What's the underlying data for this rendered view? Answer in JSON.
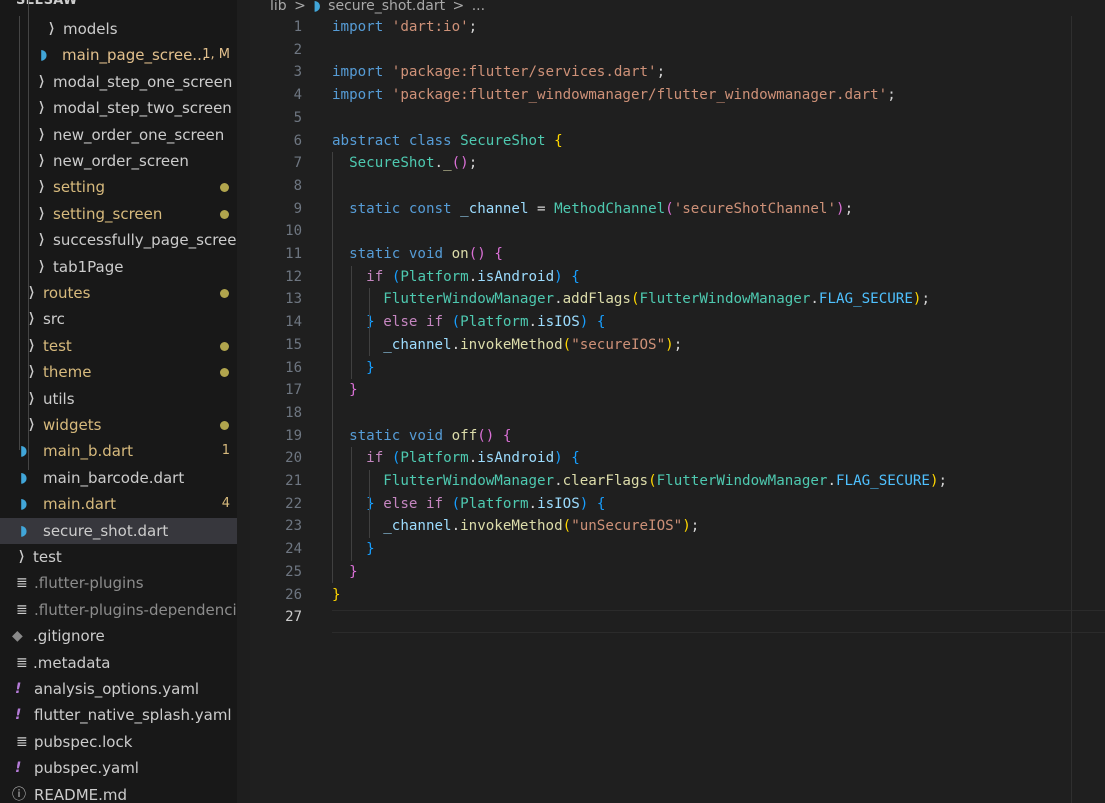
{
  "explorer": {
    "title": "SEESAW",
    "rows": [
      {
        "label": "models",
        "kind": "folder",
        "color": "#cccccc"
      },
      {
        "label": "main_page_scree...",
        "kind": "dart",
        "color": "#e2c08d",
        "badge": "1, M",
        "badge_color": "#e2c08d"
      },
      {
        "label": "modal_step_one_screen",
        "kind": "folder",
        "color": "#cccccc"
      },
      {
        "label": "modal_step_two_screen",
        "kind": "folder",
        "color": "#cccccc"
      },
      {
        "label": "new_order_one_screen",
        "kind": "folder",
        "color": "#cccccc"
      },
      {
        "label": "new_order_screen",
        "kind": "folder",
        "color": "#cccccc"
      },
      {
        "label": "setting",
        "kind": "folder",
        "color": "#d7ba7d",
        "dot": true
      },
      {
        "label": "setting_screen",
        "kind": "folder",
        "color": "#d7ba7d",
        "dot": true
      },
      {
        "label": "successfully_page_screen",
        "kind": "folder",
        "color": "#cccccc"
      },
      {
        "label": "tab1Page",
        "kind": "folder",
        "color": "#cccccc"
      },
      {
        "label": "routes",
        "kind": "folder",
        "color": "#d7ba7d",
        "dot": true
      },
      {
        "label": "src",
        "kind": "folder",
        "color": "#cccccc"
      },
      {
        "label": "test",
        "kind": "folder",
        "color": "#d7ba7d",
        "dot": true
      },
      {
        "label": "theme",
        "kind": "folder",
        "color": "#d7ba7d",
        "dot": true
      },
      {
        "label": "utils",
        "kind": "folder",
        "color": "#cccccc"
      },
      {
        "label": "widgets",
        "kind": "folder",
        "color": "#d7ba7d",
        "dot": true
      },
      {
        "label": "main_b.dart",
        "kind": "dart",
        "color": "#d7ba7d",
        "badge": "1",
        "badge_color": "#d7ba7d"
      },
      {
        "label": "main_barcode.dart",
        "kind": "dart",
        "color": "#cccccc"
      },
      {
        "label": "main.dart",
        "kind": "dart",
        "color": "#d7ba7d",
        "badge": "4",
        "badge_color": "#d7ba7d"
      },
      {
        "label": "secure_shot.dart",
        "kind": "dart",
        "color": "#cccccc",
        "selected": true
      },
      {
        "label": "test",
        "kind": "folder",
        "color": "#cccccc"
      },
      {
        "label": ".flutter-plugins",
        "kind": "lines",
        "color": "#8c8c8c"
      },
      {
        "label": ".flutter-plugins-dependencies",
        "kind": "lines",
        "color": "#8c8c8c"
      },
      {
        "label": ".gitignore",
        "kind": "git",
        "color": "#cccccc"
      },
      {
        "label": ".metadata",
        "kind": "lines",
        "color": "#cccccc"
      },
      {
        "label": "analysis_options.yaml",
        "kind": "yaml",
        "color": "#cccccc"
      },
      {
        "label": "flutter_native_splash.yaml",
        "kind": "yaml",
        "color": "#cccccc"
      },
      {
        "label": "pubspec.lock",
        "kind": "lines",
        "color": "#cccccc"
      },
      {
        "label": "pubspec.yaml",
        "kind": "yaml",
        "color": "#cccccc"
      },
      {
        "label": "README.md",
        "kind": "info",
        "color": "#cccccc"
      }
    ]
  },
  "breadcrumb": {
    "folder": "lib",
    "separator": ">",
    "file": "secure_shot.dart",
    "more": "..."
  },
  "editor": {
    "active_line": 27,
    "lines": [
      [
        [
          "kw",
          "import"
        ],
        [
          "df",
          " "
        ],
        [
          "st",
          "'dart:io'"
        ],
        [
          "df",
          ";"
        ]
      ],
      [],
      [
        [
          "kw",
          "import"
        ],
        [
          "df",
          " "
        ],
        [
          "st",
          "'package:flutter/services.dart'"
        ],
        [
          "df",
          ";"
        ]
      ],
      [
        [
          "kw",
          "import"
        ],
        [
          "df",
          " "
        ],
        [
          "st",
          "'package:flutter_windowmanager/flutter_windowmanager.dart'"
        ],
        [
          "df",
          ";"
        ]
      ],
      [],
      [
        [
          "kw",
          "abstract"
        ],
        [
          "df",
          " "
        ],
        [
          "kw",
          "class"
        ],
        [
          "df",
          " "
        ],
        [
          "ty",
          "SecureShot"
        ],
        [
          "df",
          " "
        ],
        [
          "p1",
          "{"
        ]
      ],
      [
        [
          "df",
          "  "
        ],
        [
          "ty",
          "SecureShot"
        ],
        [
          "df",
          "."
        ],
        [
          "fn",
          "_"
        ],
        [
          "p2",
          "()"
        ],
        [
          "df",
          ";"
        ]
      ],
      [],
      [
        [
          "df",
          "  "
        ],
        [
          "kw",
          "static"
        ],
        [
          "df",
          " "
        ],
        [
          "kw",
          "const"
        ],
        [
          "df",
          " "
        ],
        [
          "pr",
          "_channel"
        ],
        [
          "df",
          " = "
        ],
        [
          "ty",
          "MethodChannel"
        ],
        [
          "p2",
          "("
        ],
        [
          "st",
          "'secureShotChannel'"
        ],
        [
          "p2",
          ")"
        ],
        [
          "df",
          ";"
        ]
      ],
      [],
      [
        [
          "df",
          "  "
        ],
        [
          "kw",
          "static"
        ],
        [
          "df",
          " "
        ],
        [
          "kw",
          "void"
        ],
        [
          "df",
          " "
        ],
        [
          "fn",
          "on"
        ],
        [
          "p2",
          "()"
        ],
        [
          "df",
          " "
        ],
        [
          "p2",
          "{"
        ]
      ],
      [
        [
          "df",
          "    "
        ],
        [
          "kc",
          "if"
        ],
        [
          "df",
          " "
        ],
        [
          "p3",
          "("
        ],
        [
          "ty",
          "Platform"
        ],
        [
          "df",
          "."
        ],
        [
          "pr",
          "isAndroid"
        ],
        [
          "p3",
          ")"
        ],
        [
          "df",
          " "
        ],
        [
          "p3",
          "{"
        ]
      ],
      [
        [
          "df",
          "      "
        ],
        [
          "ty",
          "FlutterWindowManager"
        ],
        [
          "df",
          "."
        ],
        [
          "fn",
          "addFlags"
        ],
        [
          "p1",
          "("
        ],
        [
          "ty",
          "FlutterWindowManager"
        ],
        [
          "df",
          "."
        ],
        [
          "cn",
          "FLAG_SECURE"
        ],
        [
          "p1",
          ")"
        ],
        [
          "df",
          ";"
        ]
      ],
      [
        [
          "df",
          "    "
        ],
        [
          "p3",
          "}"
        ],
        [
          "df",
          " "
        ],
        [
          "kc",
          "else"
        ],
        [
          "df",
          " "
        ],
        [
          "kc",
          "if"
        ],
        [
          "df",
          " "
        ],
        [
          "p3",
          "("
        ],
        [
          "ty",
          "Platform"
        ],
        [
          "df",
          "."
        ],
        [
          "pr",
          "isIOS"
        ],
        [
          "p3",
          ")"
        ],
        [
          "df",
          " "
        ],
        [
          "p3",
          "{"
        ]
      ],
      [
        [
          "df",
          "      "
        ],
        [
          "pr",
          "_channel"
        ],
        [
          "df",
          "."
        ],
        [
          "fn",
          "invokeMethod"
        ],
        [
          "p1",
          "("
        ],
        [
          "st",
          "\"secureIOS\""
        ],
        [
          "p1",
          ")"
        ],
        [
          "df",
          ";"
        ]
      ],
      [
        [
          "df",
          "    "
        ],
        [
          "p3",
          "}"
        ]
      ],
      [
        [
          "df",
          "  "
        ],
        [
          "p2",
          "}"
        ]
      ],
      [],
      [
        [
          "df",
          "  "
        ],
        [
          "kw",
          "static"
        ],
        [
          "df",
          " "
        ],
        [
          "kw",
          "void"
        ],
        [
          "df",
          " "
        ],
        [
          "fn",
          "off"
        ],
        [
          "p2",
          "()"
        ],
        [
          "df",
          " "
        ],
        [
          "p2",
          "{"
        ]
      ],
      [
        [
          "df",
          "    "
        ],
        [
          "kc",
          "if"
        ],
        [
          "df",
          " "
        ],
        [
          "p3",
          "("
        ],
        [
          "ty",
          "Platform"
        ],
        [
          "df",
          "."
        ],
        [
          "pr",
          "isAndroid"
        ],
        [
          "p3",
          ")"
        ],
        [
          "df",
          " "
        ],
        [
          "p3",
          "{"
        ]
      ],
      [
        [
          "df",
          "      "
        ],
        [
          "ty",
          "FlutterWindowManager"
        ],
        [
          "df",
          "."
        ],
        [
          "fn",
          "clearFlags"
        ],
        [
          "p1",
          "("
        ],
        [
          "ty",
          "FlutterWindowManager"
        ],
        [
          "df",
          "."
        ],
        [
          "cn",
          "FLAG_SECURE"
        ],
        [
          "p1",
          ")"
        ],
        [
          "df",
          ";"
        ]
      ],
      [
        [
          "df",
          "    "
        ],
        [
          "p3",
          "}"
        ],
        [
          "df",
          " "
        ],
        [
          "kc",
          "else"
        ],
        [
          "df",
          " "
        ],
        [
          "kc",
          "if"
        ],
        [
          "df",
          " "
        ],
        [
          "p3",
          "("
        ],
        [
          "ty",
          "Platform"
        ],
        [
          "df",
          "."
        ],
        [
          "pr",
          "isIOS"
        ],
        [
          "p3",
          ")"
        ],
        [
          "df",
          " "
        ],
        [
          "p3",
          "{"
        ]
      ],
      [
        [
          "df",
          "      "
        ],
        [
          "pr",
          "_channel"
        ],
        [
          "df",
          "."
        ],
        [
          "fn",
          "invokeMethod"
        ],
        [
          "p1",
          "("
        ],
        [
          "st",
          "\"unSecureIOS\""
        ],
        [
          "p1",
          ")"
        ],
        [
          "df",
          ";"
        ]
      ],
      [
        [
          "df",
          "    "
        ],
        [
          "p3",
          "}"
        ]
      ],
      [
        [
          "df",
          "  "
        ],
        [
          "p2",
          "}"
        ]
      ],
      [
        [
          "p1",
          "}"
        ]
      ],
      []
    ]
  }
}
